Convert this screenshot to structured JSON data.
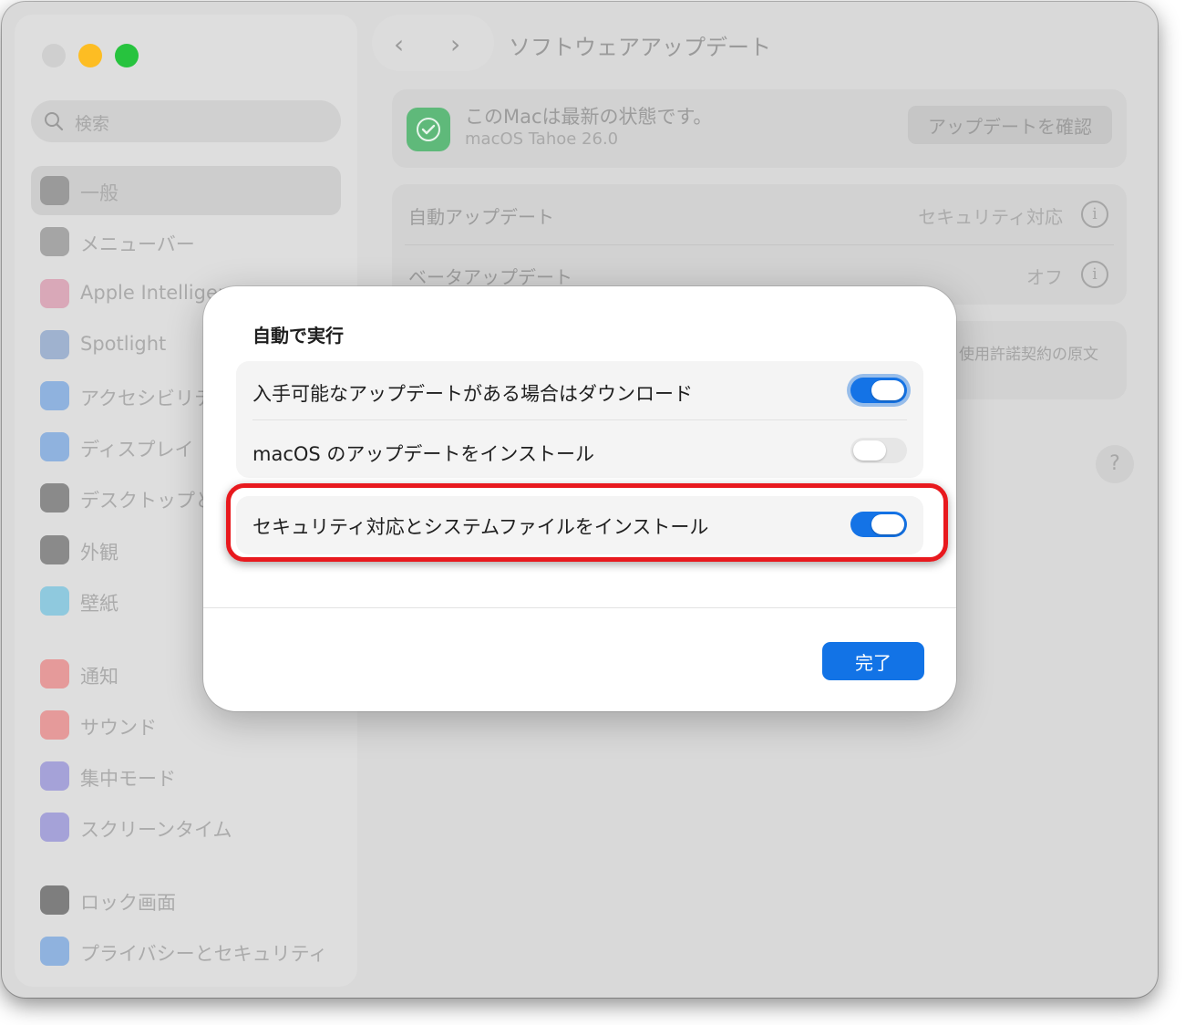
{
  "window": {
    "title": "ソフトウェアアップデート"
  },
  "sidebar": {
    "search_placeholder": "検索",
    "items": [
      {
        "label": "一般",
        "icon": "gear-icon",
        "color": "#9a9a9a"
      },
      {
        "label": "メニューバー",
        "icon": "menubar-icon",
        "color": "#a5a5a5"
      },
      {
        "label": "Apple Intelligence",
        "icon": "apple-intelligence-icon",
        "color": "#d9a8b8"
      },
      {
        "label": "Spotlight",
        "icon": "spotlight-icon",
        "color": "#9fb2cf"
      },
      {
        "label": "アクセシビリティ",
        "icon": "accessibility-icon",
        "color": "#8fb2de"
      },
      {
        "label": "ディスプレイ",
        "icon": "display-icon",
        "color": "#8fb2de"
      },
      {
        "label": "デスクトップとDock",
        "icon": "dock-icon",
        "color": "#8a8a8a"
      },
      {
        "label": "外観",
        "icon": "appearance-icon",
        "color": "#8a8a8a"
      },
      {
        "label": "壁紙",
        "icon": "wallpaper-icon",
        "color": "#8fc9de"
      },
      {
        "label": "通知",
        "icon": "notifications-icon",
        "color": "#e59a9a"
      },
      {
        "label": "サウンド",
        "icon": "sound-icon",
        "color": "#e59a9a"
      },
      {
        "label": "集中モード",
        "icon": "focus-icon",
        "color": "#a5a2d8"
      },
      {
        "label": "スクリーンタイム",
        "icon": "screentime-icon",
        "color": "#a5a2d8"
      },
      {
        "label": "ロック画面",
        "icon": "lock-icon",
        "color": "#7e7e7e"
      },
      {
        "label": "プライバシーとセキュリティ",
        "icon": "hand-icon",
        "color": "#8fb2de"
      }
    ]
  },
  "status": {
    "title": "このMacは最新の状態です。",
    "version": "macOS Tahoe 26.0",
    "check_button": "アップデートを確認"
  },
  "settings": [
    {
      "label": "自動アップデート",
      "value": "セキュリティ対応"
    },
    {
      "label": "ベータアップデート",
      "value": "オフ"
    }
  ],
  "license_text": "使用許諾契約の原文",
  "help": "?",
  "dialog": {
    "heading": "自動で実行",
    "options": [
      {
        "label": "入手可能なアップデートがある場合はダウンロード",
        "state": "on"
      },
      {
        "label": "macOS のアップデートをインストール",
        "state": "off"
      },
      {
        "label": "セキュリティ対応とシステムファイルをインストール",
        "state": "on"
      }
    ],
    "done_button": "完了"
  },
  "colors": {
    "accent": "#1473e6",
    "highlight": "#e8191e"
  }
}
